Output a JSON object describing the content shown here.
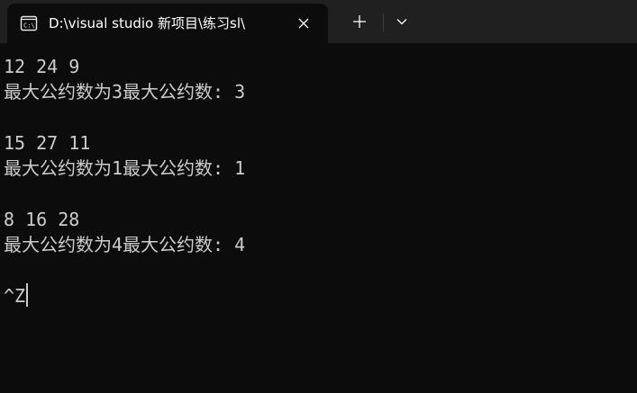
{
  "titlebar": {
    "tab_title": "D:\\visual studio 新项目\\练习sl\\",
    "tab_icon": "console-icon",
    "close_icon": "close-icon",
    "new_tab_icon": "plus-icon",
    "dropdown_icon": "chevron-down-icon"
  },
  "console": {
    "lines": [
      "12 24 9",
      "最大公约数为3最大公约数: 3",
      "",
      "15 27 11",
      "最大公约数为1最大公约数: 1",
      "",
      "8 16 28",
      "最大公约数为4最大公约数: 4",
      "",
      "^Z"
    ]
  },
  "colors": {
    "titlebar_bg": "#202020",
    "console_bg": "#0c0c0c",
    "console_text": "#cccccc",
    "tab_text": "#ffffff"
  }
}
